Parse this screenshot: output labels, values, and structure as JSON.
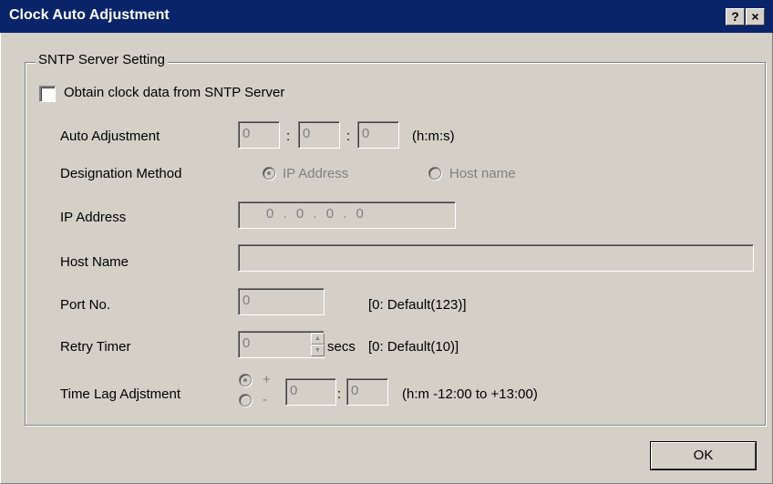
{
  "window": {
    "title": "Clock Auto Adjustment",
    "help_label": "?",
    "close_label": "×"
  },
  "group": {
    "legend": "SNTP Server Setting"
  },
  "obtain_checkbox": {
    "label": "Obtain clock data from SNTP Server",
    "checked": false
  },
  "auto_adjustment": {
    "label": "Auto Adjustment",
    "hours": "0",
    "minutes": "0",
    "seconds": "0",
    "sep": ":",
    "hint": "(h:m:s)"
  },
  "designation_method": {
    "label": "Designation Method",
    "option_ip": "IP Address",
    "option_host": "Host name",
    "selected": "IP Address"
  },
  "ip_address": {
    "label": "IP Address",
    "value": "0 . 0 . 0 . 0"
  },
  "host_name": {
    "label": "Host Name",
    "value": ""
  },
  "port": {
    "label": "Port No.",
    "value": "0",
    "hint": "[0: Default(123)]"
  },
  "retry_timer": {
    "label": "Retry Timer",
    "value": "0",
    "unit": "secs",
    "hint": "[0: Default(10)]"
  },
  "time_lag": {
    "label": "Time Lag Adjstment",
    "plus": "+",
    "minus": "-",
    "selected": "+",
    "hours": "0",
    "minutes": "0",
    "sep": ":",
    "hint": "(h:m  -12:00 to +13:00)"
  },
  "buttons": {
    "ok_label": "OK"
  },
  "colors": {
    "titlebar": "#0a246a",
    "face": "#d4d0c8",
    "disabled_text": "#808080"
  }
}
